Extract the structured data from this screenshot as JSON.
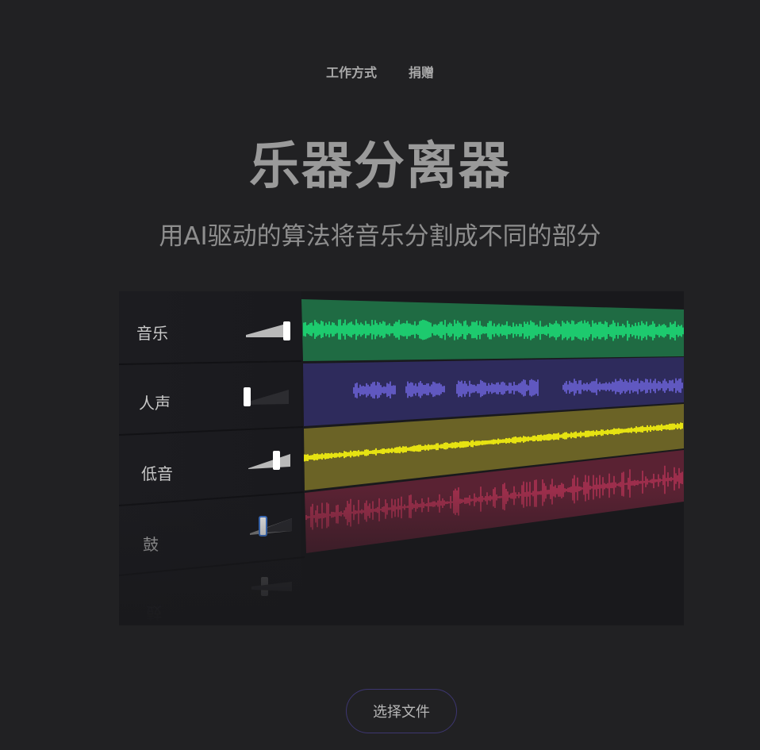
{
  "nav": {
    "items": [
      "工作方式",
      "捐赠"
    ]
  },
  "hero": {
    "title": "乐器分离器",
    "subtitle": "用AI驱动的算法将音乐分割成不同的部分"
  },
  "demo": {
    "tracks": [
      {
        "label": "音乐",
        "level": 1.0,
        "color": "#1f6b43",
        "wave": "#1de37a"
      },
      {
        "label": "人声",
        "level": 0.0,
        "color": "#2e2b5c",
        "wave": "#6d63d9"
      },
      {
        "label": "低音",
        "level": 0.7,
        "color": "#6b6326",
        "wave": "#f4f011"
      },
      {
        "label": "鼓",
        "level": 0.3,
        "color": "#5a2233",
        "wave": "#c9375c"
      }
    ],
    "reflection_label": "鼓"
  },
  "cta": {
    "label": "选择文件"
  }
}
